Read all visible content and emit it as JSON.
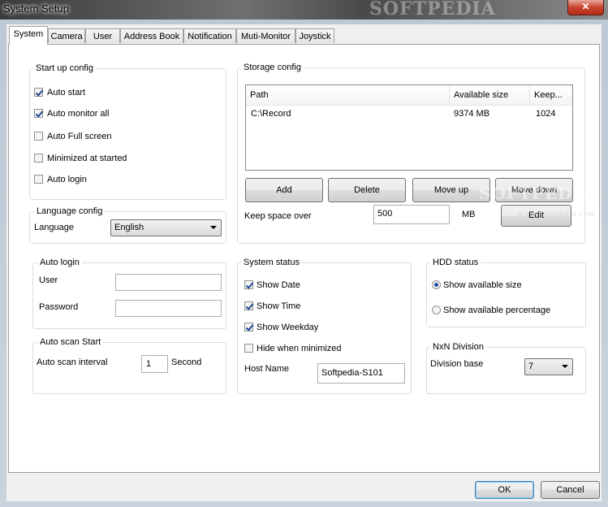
{
  "window": {
    "title": "System Setup",
    "close_glyph": "✕"
  },
  "tabs": [
    {
      "label": "System"
    },
    {
      "label": "Camera"
    },
    {
      "label": "User"
    },
    {
      "label": "Address Book"
    },
    {
      "label": "Notification"
    },
    {
      "label": "Muti-Monitor"
    },
    {
      "label": "Joystick"
    }
  ],
  "startup": {
    "title": "Start up config",
    "items": [
      {
        "label": "Auto start",
        "checked": true
      },
      {
        "label": "Auto monitor all",
        "checked": true
      },
      {
        "label": "Auto Full screen",
        "checked": false
      },
      {
        "label": "Minimized at started",
        "checked": false
      },
      {
        "label": "Auto login",
        "checked": false
      }
    ]
  },
  "language": {
    "title": "Language config",
    "label": "Language",
    "value": "English"
  },
  "autologin": {
    "title": "Auto login",
    "user_label": "User",
    "user_value": "",
    "password_label": "Password",
    "password_value": ""
  },
  "autoscan": {
    "title": "Auto scan Start",
    "interval_label": "Auto scan interval",
    "interval_value": "1",
    "unit": "Second"
  },
  "storage": {
    "title": "Storage config",
    "columns": [
      "Path",
      "Available size",
      "Keep..."
    ],
    "rows": [
      {
        "path": "C:\\Record",
        "available": "9374 MB",
        "keep": "1024"
      }
    ],
    "buttons": {
      "add": "Add",
      "delete": "Delete",
      "move_up": "Move up",
      "move_down": "Move down",
      "edit": "Edit"
    },
    "keep_label": "Keep space over",
    "keep_value": "500",
    "keep_unit": "MB"
  },
  "sysstatus": {
    "title": "System status",
    "items": [
      {
        "label": "Show Date",
        "checked": true
      },
      {
        "label": "Show Time",
        "checked": true
      },
      {
        "label": "Show Weekday",
        "checked": true
      },
      {
        "label": "Hide when minimized",
        "checked": false
      }
    ],
    "host_label": "Host Name",
    "host_value": "Softpedia-S101"
  },
  "hdd": {
    "title": "HDD status",
    "options": [
      {
        "label": "Show available size",
        "selected": true
      },
      {
        "label": "Show available percentage",
        "selected": false
      }
    ]
  },
  "division": {
    "title": "NxN Division",
    "label": "Division base",
    "value": "7"
  },
  "footer": {
    "ok": "OK",
    "cancel": "Cancel"
  },
  "watermarks": {
    "top": "SOFTPEDIA",
    "middle": "SOFTPEDIA",
    "small": "www.softpedia.com"
  },
  "colors": {
    "check_mark": "#21478e",
    "close_button": "#c8452f",
    "default_button_border": "#3c7fb1"
  }
}
